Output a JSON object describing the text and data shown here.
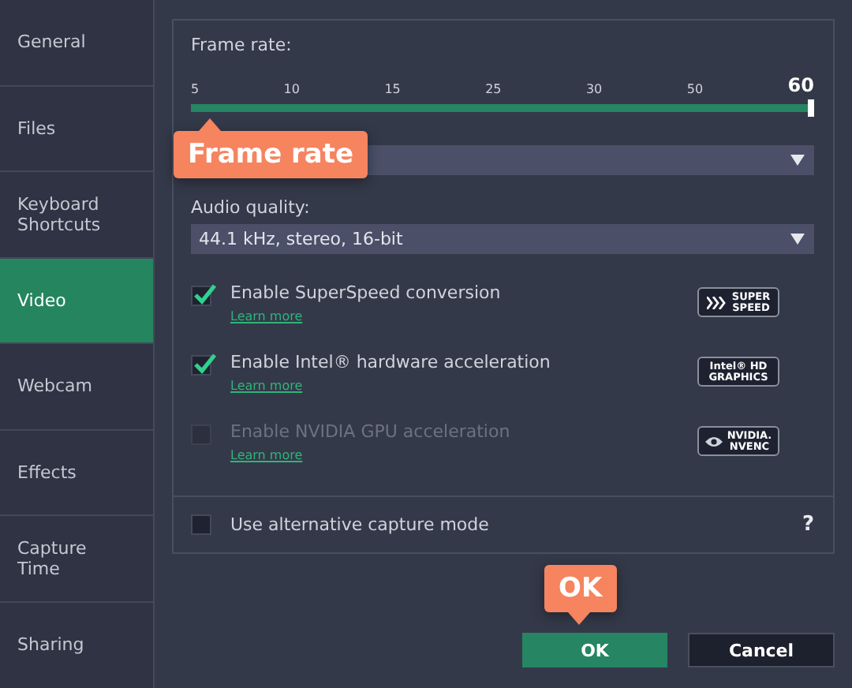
{
  "sidebar": {
    "items": [
      {
        "label": "General",
        "selected": false
      },
      {
        "label": "Files",
        "selected": false
      },
      {
        "label": "Keyboard Shortcuts",
        "selected": false
      },
      {
        "label": "Video",
        "selected": true
      },
      {
        "label": "Webcam",
        "selected": false
      },
      {
        "label": "Effects",
        "selected": false
      },
      {
        "label": "Capture Time",
        "selected": false
      },
      {
        "label": "Sharing",
        "selected": false
      }
    ]
  },
  "frame_rate": {
    "label": "Frame rate:",
    "level": 1,
    "callout": "Frame rate",
    "ticks": [
      {
        "label": "5",
        "selected": false
      },
      {
        "label": "10",
        "selected": false
      },
      {
        "label": "15",
        "selected": false
      },
      {
        "label": "25",
        "selected": false
      },
      {
        "label": "30",
        "selected": false
      },
      {
        "label": "50",
        "selected": false
      },
      {
        "label": "60",
        "selected": true
      }
    ]
  },
  "audio_quality": {
    "label": "Audio quality:",
    "value": "44.1 kHz, stereo, 16-bit"
  },
  "options": [
    {
      "label": "Enable SuperSpeed conversion",
      "checked": true,
      "disabled": false,
      "link": "Learn more",
      "kind": "chevrons",
      "badge": [
        "SUPER",
        "SPEED"
      ]
    },
    {
      "label": "Enable Intel® hardware acceleration",
      "checked": true,
      "disabled": false,
      "link": "Learn more",
      "kind": "text",
      "badge": [
        "Intel® HD",
        "GRAPHICS"
      ]
    },
    {
      "label": "Enable NVIDIA GPU acceleration",
      "checked": false,
      "disabled": true,
      "link": "Learn more",
      "kind": "eye",
      "badge": [
        "NVIDIA.",
        "NVENC"
      ]
    }
  ],
  "alt_capture": {
    "label": "Use alternative capture mode",
    "checked": false
  },
  "help": "?",
  "buttons": [
    {
      "label": "OK",
      "kind": "primary",
      "callout": "OK"
    },
    {
      "label": "Cancel",
      "kind": "secondary"
    }
  ]
}
